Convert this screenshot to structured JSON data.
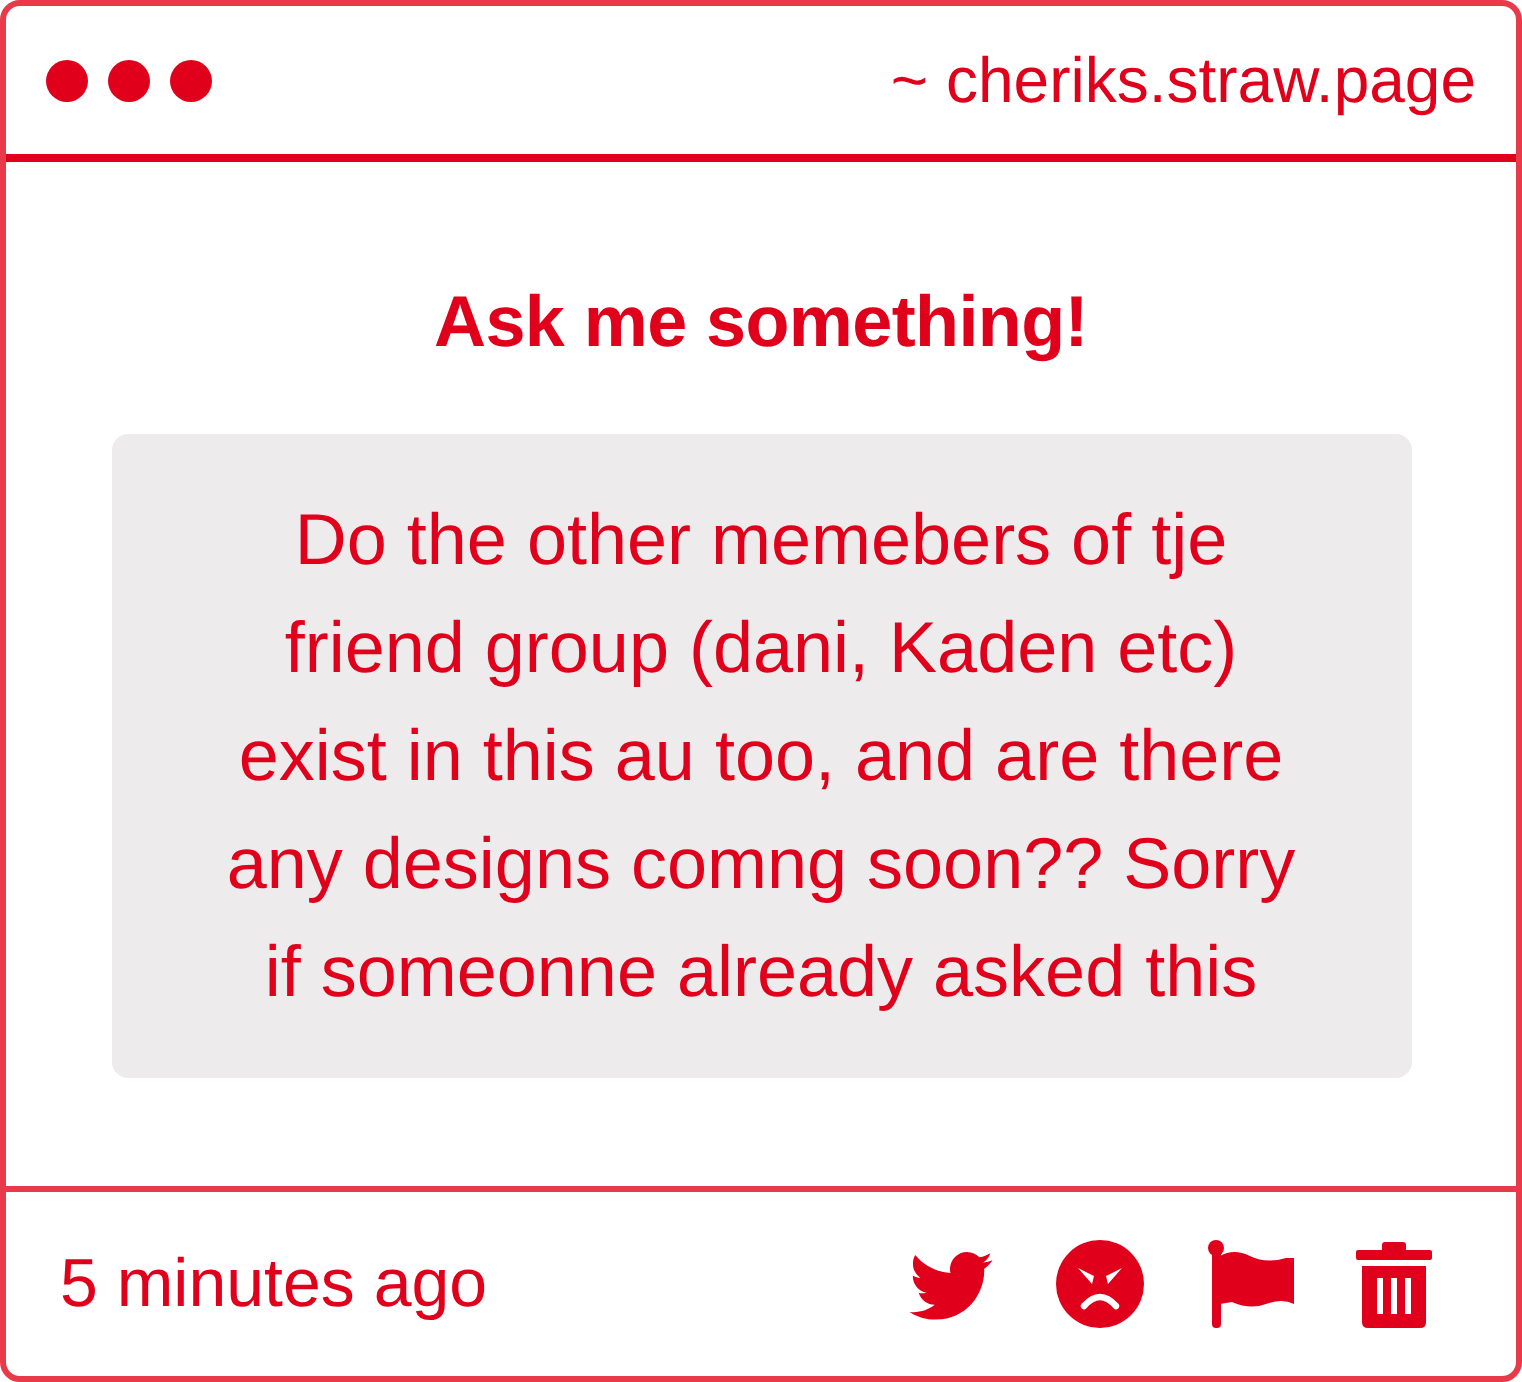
{
  "window": {
    "address": "~ cheriks.straw.page"
  },
  "title": "Ask me something!",
  "question": "Do the other memebers of tje friend group (dani, Kaden etc) exist in this au too, and are there any designs comng soon?? Sorry if someonne already asked this",
  "footer": {
    "time": "5 minutes ago"
  }
}
